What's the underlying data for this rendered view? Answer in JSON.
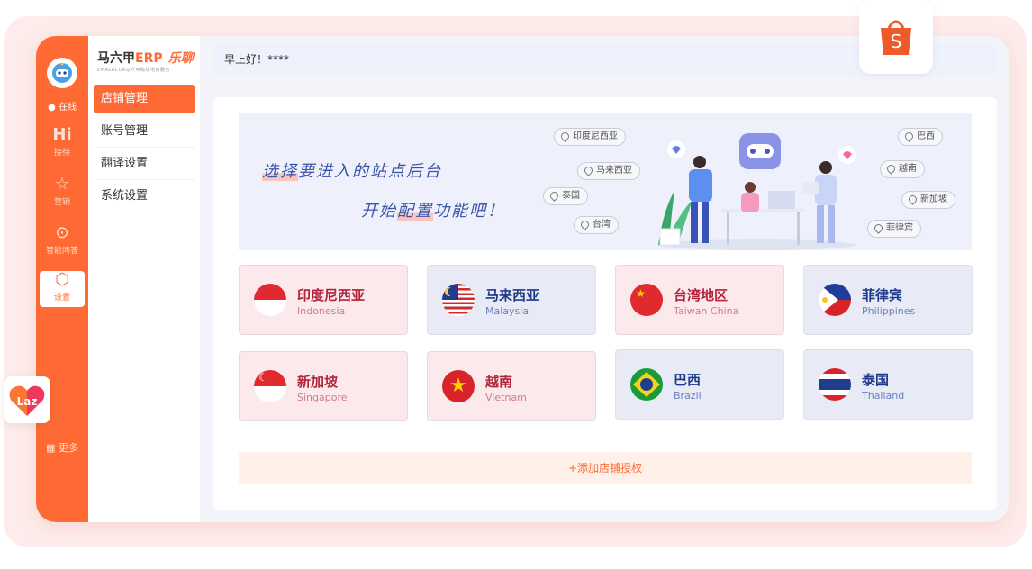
{
  "header": {
    "greeting": "早上好！****"
  },
  "brand": {
    "name": "马六甲",
    "erp": "ERP",
    "partner": "乐聊",
    "tagline": "EMALACCA马六甲跨境电商服务"
  },
  "rail": {
    "status": "在线",
    "items": [
      {
        "label": "接待",
        "icon": "hi-icon"
      },
      {
        "label": "营销",
        "icon": "star-box-icon"
      },
      {
        "label": "智能问答",
        "icon": "chat-bubble-icon"
      },
      {
        "label": "设置",
        "icon": "settings-icon"
      }
    ],
    "more": "更多"
  },
  "menu": {
    "items": [
      "店铺管理",
      "账号管理",
      "翻译设置",
      "系统设置"
    ],
    "active": "店铺管理"
  },
  "banner": {
    "slogan1": [
      "选择",
      "要进入的站点后台"
    ],
    "slogan2": [
      "开始",
      "配置",
      "功能吧！"
    ],
    "pins": [
      "印度尼西亚",
      "马来西亚",
      "泰国",
      "台湾",
      "巴西",
      "越南",
      "新加坡",
      "菲律宾"
    ]
  },
  "sites": [
    {
      "cn": "印度尼西亚",
      "en": "Indonesia"
    },
    {
      "cn": "马来西亚",
      "en": "Malaysia"
    },
    {
      "cn": "台湾地区",
      "en": "Taiwan China"
    },
    {
      "cn": "菲律宾",
      "en": "Philippines"
    },
    {
      "cn": "新加坡",
      "en": "Singapore"
    },
    {
      "cn": "越南",
      "en": "Vietnam"
    },
    {
      "cn": "巴西",
      "en": "Brazil"
    },
    {
      "cn": "泰国",
      "en": "Thailand"
    }
  ],
  "add_label": "+添加店铺授权",
  "badges": {
    "shopee": "S",
    "lazada": "Laz"
  },
  "colors": {
    "accent": "#ff6a34",
    "pink_card": "#fbe9ec",
    "blue_card": "#e8ebf6"
  }
}
